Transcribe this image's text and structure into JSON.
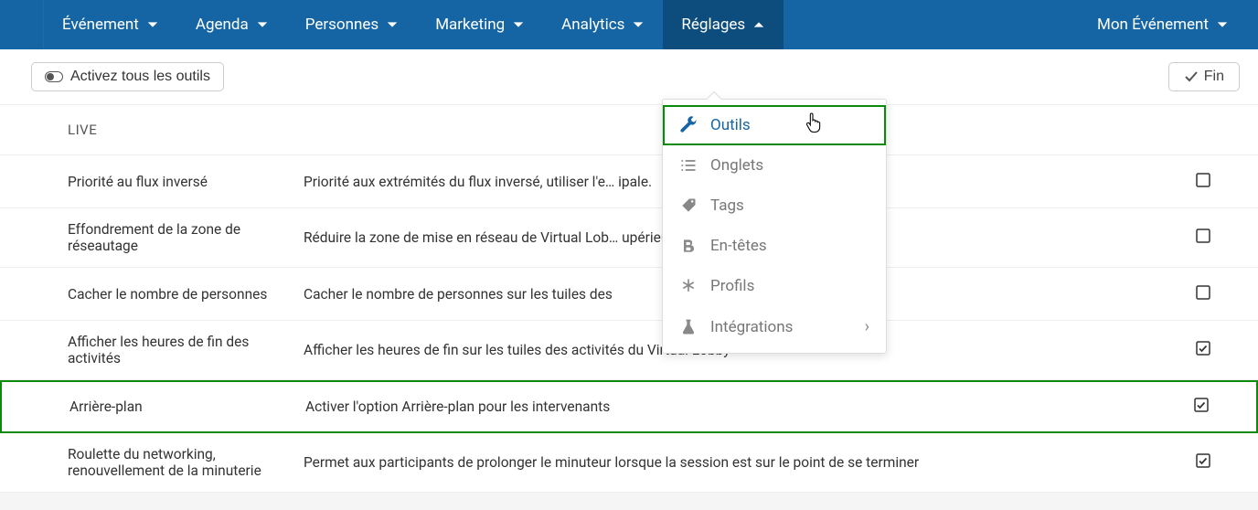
{
  "nav": {
    "items": [
      {
        "label": "Événement"
      },
      {
        "label": "Agenda"
      },
      {
        "label": "Personnes"
      },
      {
        "label": "Marketing"
      },
      {
        "label": "Analytics"
      },
      {
        "label": "Réglages"
      }
    ],
    "right": {
      "label": "Mon Événement"
    }
  },
  "toolbar": {
    "toggle_label": "Activez tous les outils",
    "fin_label": "Fin"
  },
  "section": {
    "header": "LIVE"
  },
  "dropdown": {
    "items": [
      {
        "label": "Outils"
      },
      {
        "label": "Onglets"
      },
      {
        "label": "Tags"
      },
      {
        "label": "En-têtes"
      },
      {
        "label": "Profils"
      },
      {
        "label": "Intégrations"
      }
    ]
  },
  "rows": [
    {
      "name": "Priorité au flux inversé",
      "desc": "Priorité aux extrémités du flux inversé, utiliser l'e…                                                 ipale.",
      "checked": false
    },
    {
      "name": "Effondrement de la zone de réseautage",
      "desc": "Réduire la zone de mise en réseau de Virtual Lob…                                             upérieure",
      "checked": false
    },
    {
      "name": "Cacher le nombre de personnes",
      "desc": "Cacher le nombre de personnes sur les tuiles des",
      "checked": false
    },
    {
      "name": "Afficher les heures de fin des activités",
      "desc": "Afficher les heures de fin sur les tuiles des activités du Virtual Lobby",
      "checked": true
    },
    {
      "name": "Arrière-plan",
      "desc": "Activer l'option Arrière-plan pour les intervenants",
      "checked": true,
      "highlighted": true
    },
    {
      "name": "Roulette du networking, renouvellement de la minuterie",
      "desc": "Permet aux participants de prolonger le minuteur lorsque la session est sur le point de se terminer",
      "checked": true
    }
  ]
}
